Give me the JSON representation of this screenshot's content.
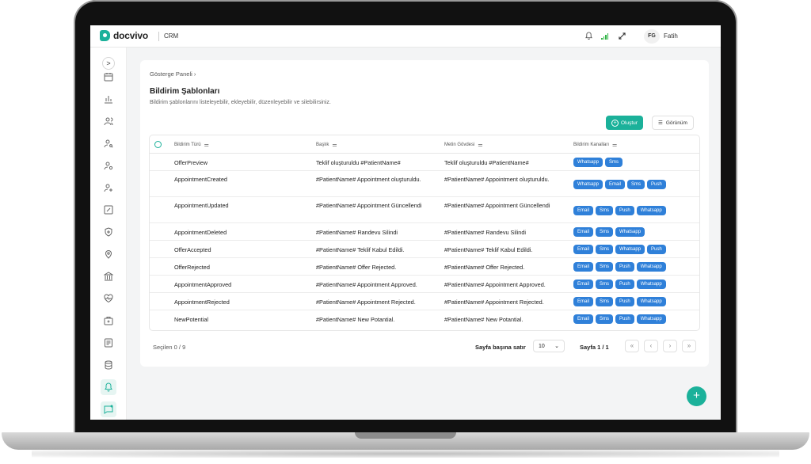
{
  "brand": {
    "name": "docvivo",
    "module": "CRM",
    "accent": "#1bb19a",
    "badge_color": "#2f80d9"
  },
  "user": {
    "initials": "FG",
    "name": "Fatih"
  },
  "topbar_icons": [
    "bell-icon",
    "signal-icon",
    "fullscreen-icon"
  ],
  "sidebar": {
    "toggle": ">",
    "items": [
      "calendar-icon",
      "chart-icon",
      "users-icon",
      "user-search-icon",
      "user-settings-icon",
      "user-add-icon",
      "percent-icon",
      "shield-icon",
      "location-icon",
      "bank-icon",
      "heart-pulse-icon",
      "briefcase-icon",
      "document-icon",
      "database-icon",
      "bell-icon",
      "message-icon"
    ],
    "active": "message-icon"
  },
  "page": {
    "breadcrumb": "Gösterge Paneli",
    "title": "Bildirim Şablonları",
    "subtitle": "Bildirim şablonlarını listeleyebilir, ekleyebilir, düzenleyebilir ve silebilirsiniz."
  },
  "actions": {
    "create": "Oluştur",
    "view": "Görünüm"
  },
  "table": {
    "columns": [
      "Bildirim Türü",
      "Başlık",
      "Metin Gövdesi",
      "Bildirim Kanalları"
    ],
    "rows": [
      {
        "type": "OfferPreview",
        "title": "Teklif oluşturuldu #PatientName#",
        "body": "Teklif oluşturuldu #PatientName#",
        "channels": [
          "Whatsapp",
          "Sms"
        ]
      },
      {
        "type": "AppointmentCreated",
        "title": "#PatientName# Appointment oluşturuldu.",
        "body": "#PatientName# Appointment oluşturuldu.",
        "channels": [
          "Whatsapp",
          "Email",
          "Sms",
          "Push"
        ]
      },
      {
        "type": "AppointmentUpdated",
        "title": "#PatientName# Appointment Güncellendi",
        "body": "#PatientName# Appointment Güncellendi",
        "channels": [
          "Email",
          "Sms",
          "Push",
          "Whatsapp"
        ]
      },
      {
        "type": "AppointmentDeleted",
        "title": "#PatientName# Randevu Silindi",
        "body": "#PatientName# Randevu Silindi",
        "channels": [
          "Email",
          "Sms",
          "Whatsapp"
        ]
      },
      {
        "type": "OfferAccepted",
        "title": "#PatientName# Teklif Kabul Edildi.",
        "body": "#PatientName# Teklif Kabul Edildi.",
        "channels": [
          "Email",
          "Sms",
          "Whatsapp",
          "Push"
        ]
      },
      {
        "type": "OfferRejected",
        "title": "#PatientName# Offer Rejected.",
        "body": "#PatientName# Offer Rejected.",
        "channels": [
          "Email",
          "Sms",
          "Push",
          "Whatsapp"
        ]
      },
      {
        "type": "AppointmentApproved",
        "title": "#PatientName# Appointment Approved.",
        "body": "#PatientName# Appointment Approved.",
        "channels": [
          "Email",
          "Sms",
          "Push",
          "Whatsapp"
        ]
      },
      {
        "type": "AppointmentRejected",
        "title": "#PatientName# Appointment Rejected.",
        "body": "#PatientName# Appointment Rejected.",
        "channels": [
          "Email",
          "Sms",
          "Push",
          "Whatsapp"
        ]
      },
      {
        "type": "NewPotential",
        "title": "#PatientName# New Potantial.",
        "body": "#PatientName# New Potantial.",
        "channels": [
          "Email",
          "Sms",
          "Push",
          "Whatsapp"
        ]
      }
    ]
  },
  "footer": {
    "selected": "Seçilen 0 / 9",
    "rows_per_page_label": "Sayfa başına satır",
    "rows_per_page": "10",
    "page": "Sayfa 1 / 1",
    "pager": [
      "«",
      "‹",
      "›",
      "»"
    ]
  },
  "fab": "+"
}
